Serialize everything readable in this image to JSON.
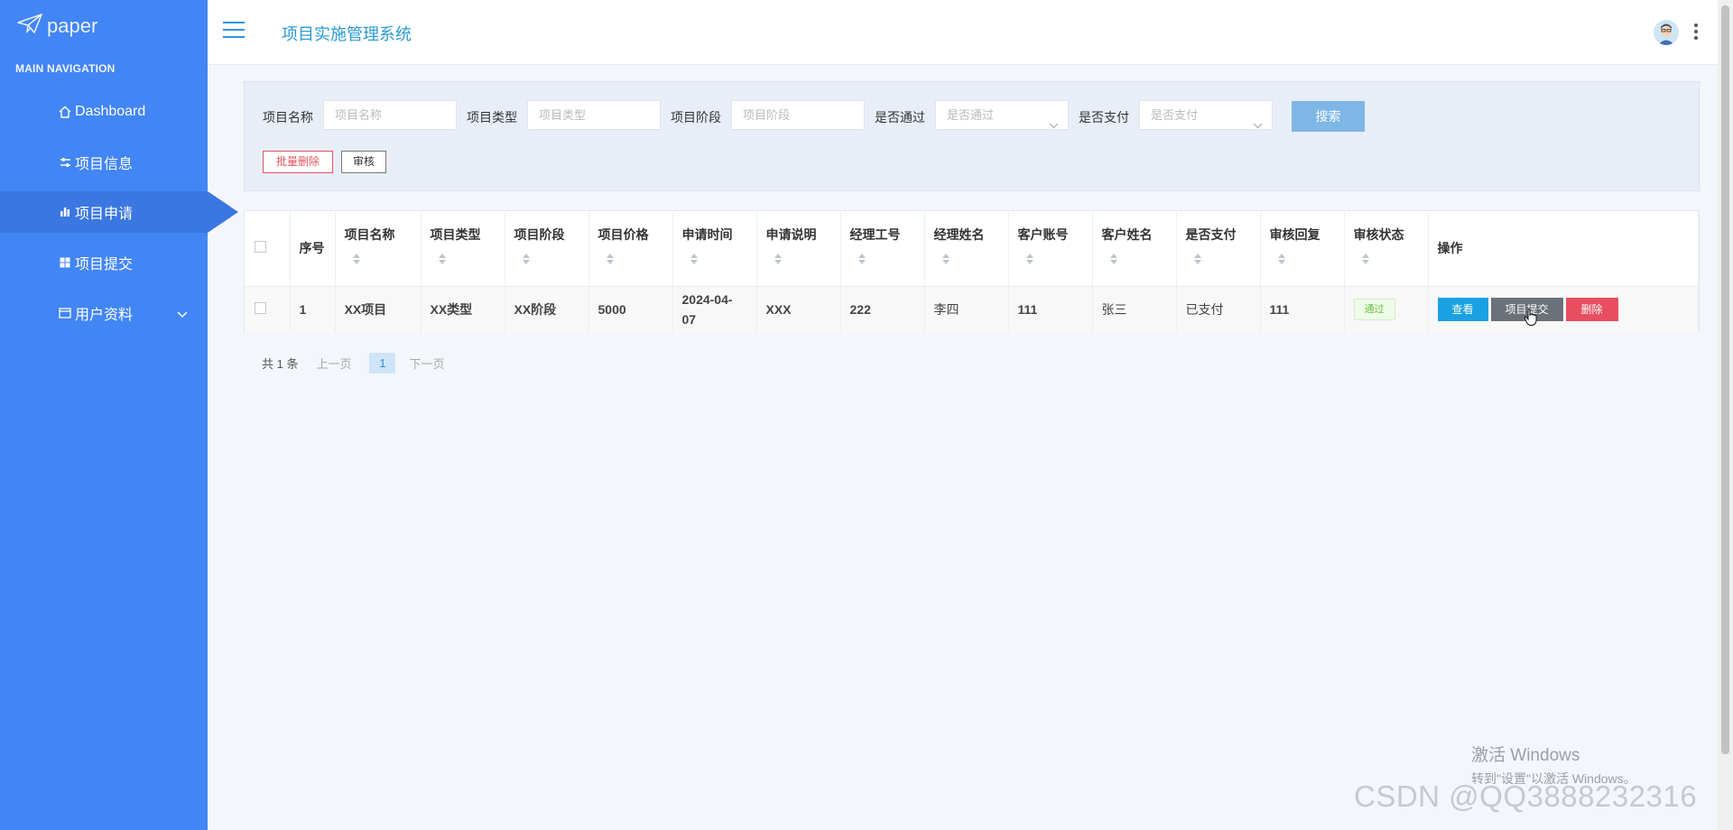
{
  "brand": {
    "logo_text": "paper",
    "accent": "#4285f4"
  },
  "sidebar": {
    "section_title": "MAIN NAVIGATION",
    "items": [
      {
        "label": "Dashboard",
        "icon": "home-icon"
      },
      {
        "label": "项目信息",
        "icon": "sliders-icon"
      },
      {
        "label": "项目申请",
        "icon": "bar-chart-icon",
        "active": true
      },
      {
        "label": "项目提交",
        "icon": "grid-icon"
      },
      {
        "label": "用户资料",
        "icon": "card-icon",
        "expandable": true
      }
    ]
  },
  "header": {
    "title": "项目实施管理系统"
  },
  "search": {
    "fields": [
      {
        "label": "项目名称",
        "placeholder": "项目名称"
      },
      {
        "label": "项目类型",
        "placeholder": "项目类型"
      },
      {
        "label": "项目阶段",
        "placeholder": "项目阶段"
      },
      {
        "label": "是否通过",
        "placeholder": "是否通过"
      },
      {
        "label": "是否支付",
        "placeholder": "是否支付"
      }
    ],
    "search_button": "搜索",
    "batch_delete_button": "批量删除",
    "audit_button": "审核"
  },
  "table": {
    "columns": [
      "序号",
      "项目名称",
      "项目类型",
      "项目阶段",
      "项目价格",
      "申请时间",
      "申请说明",
      "经理工号",
      "经理姓名",
      "客户账号",
      "客户姓名",
      "是否支付",
      "审核回复",
      "审核状态",
      "操作"
    ],
    "rows": [
      {
        "index": "1",
        "name": "XX项目",
        "type": "XX类型",
        "stage": "XX阶段",
        "price": "5000",
        "apply_time_line1": "2024-04-",
        "apply_time_line2": "07",
        "description": "XXX",
        "manager_id": "222",
        "manager_name": "李四",
        "customer_account": "111",
        "customer_name": "张三",
        "paid": "已支付",
        "audit_reply": "111",
        "audit_status": "通过",
        "actions": {
          "view": "查看",
          "submit": "项目提交",
          "delete": "删除"
        }
      }
    ]
  },
  "pagination": {
    "total": "共 1 条",
    "prev": "上一页",
    "page": "1",
    "next": "下一页"
  },
  "watermark": {
    "windows_line1": "激活 Windows",
    "windows_line2": "转到\"设置\"以激活 Windows。",
    "csdn": "CSDN @QQ3888232316"
  }
}
